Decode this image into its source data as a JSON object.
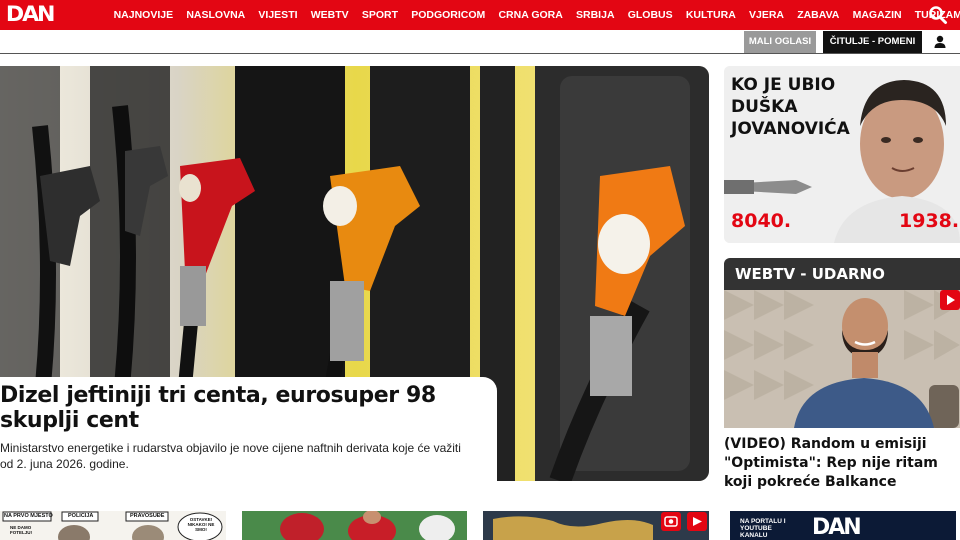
{
  "header": {
    "logo": "DAN",
    "nav": [
      "NAJNOVIJE",
      "NASLOVNA",
      "VIJESTI",
      "WEBTV",
      "SPORT",
      "PODGORICOM",
      "CRNA GORA",
      "SRBIJA",
      "GLOBUS",
      "KULTURA",
      "VJERA",
      "ZABAVA",
      "MAGAZIN",
      "TURIZAM"
    ],
    "search_icon": "search-icon",
    "colors": {
      "brand": "#e30613"
    }
  },
  "subbar": {
    "mali_oglasi": "MALI OGLASI",
    "citulje": "ČITULJE - POMENI",
    "user_icon": "user-icon"
  },
  "hero": {
    "title": "Dizel jeftiniji tri centa, eurosuper 98 skuplji cent",
    "lead": "Ministarstvo energetike i rudarstva objavilo je nove cijene naftnih derivata koje će važiti od 2. juna 2026. godine.",
    "slides": 3,
    "active_slide": 1
  },
  "promo": {
    "title": "KO JE UBIO DUŠKA JOVANOVIĆA",
    "left_number": "8040.",
    "right_number": "1938."
  },
  "webtv": {
    "heading": "WEBTV - UDARNO",
    "video_title": "(VIDEO) Random u emisiji \"Optimista\": Rep nije ritam koji pokreće Balkance"
  },
  "thumbs": {
    "cartoon_labels": [
      "NA PRVO MJESTO",
      "POLICIJA",
      "PRAVOSUĐE",
      "OSTAVKE! NIKAKO! NE SMO!"
    ],
    "cartoon_left": "NE DAMO FOTELJU!",
    "banner_text": "NA PORTALU I YOUTUBE KANALU"
  }
}
